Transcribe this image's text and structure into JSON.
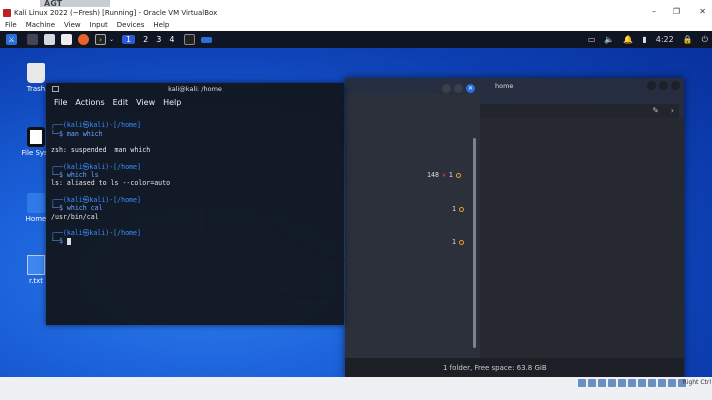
{
  "window": {
    "title": "Kali Linux 2022 (~Fresh) [Running] - Oracle VM VirtualBox",
    "controls": [
      "–",
      "❐",
      "✕"
    ]
  },
  "vbox_menu": [
    "File",
    "Machine",
    "View",
    "Input",
    "Devices",
    "Help"
  ],
  "banner": "AGT",
  "panel": {
    "workspaces": [
      "1",
      "2",
      "3",
      "4"
    ],
    "clock": "4:22",
    "active_workspace": "1"
  },
  "desktop_icons": [
    {
      "label": "Trash",
      "icon": "trash-icon"
    },
    {
      "label": "File Syst",
      "icon": "filesystem-icon"
    },
    {
      "label": "Home",
      "icon": "home-folder-icon"
    },
    {
      "label": "r.txt",
      "icon": "text-file-icon"
    }
  ],
  "terminal": {
    "title": "kali@kali: /home",
    "menu": [
      "File",
      "Actions",
      "Edit",
      "View",
      "Help"
    ],
    "lines": {
      "p1": "┌──(kali㉿kali)-[/home]",
      "c1": "└─$ man which",
      "o1": "zsh: suspended  man which",
      "p2": "┌──(kali㉿kali)-[/home]",
      "c2": "└─$ which ls",
      "o2": "ls: aliased to ls --color=auto",
      "p3": "┌──(kali㉿kali)-[/home]",
      "c3": "└─$ which cal",
      "o3": "/usr/bin/cal",
      "p4": "┌──(kali㉿kali)-[/home]",
      "c4": "└─$ "
    },
    "right_prompts": [
      {
        "code": "148",
        "x": "✕",
        "count": "1"
      },
      {
        "code": "",
        "x": "",
        "count": "1"
      },
      {
        "code": "",
        "x": "",
        "count": "1"
      }
    ]
  },
  "file_manager": {
    "title": "home",
    "status": "1 folder, Free space: 63.8 GiB"
  },
  "vbox_status": {
    "right_ctrl": "Right Ctrl"
  }
}
